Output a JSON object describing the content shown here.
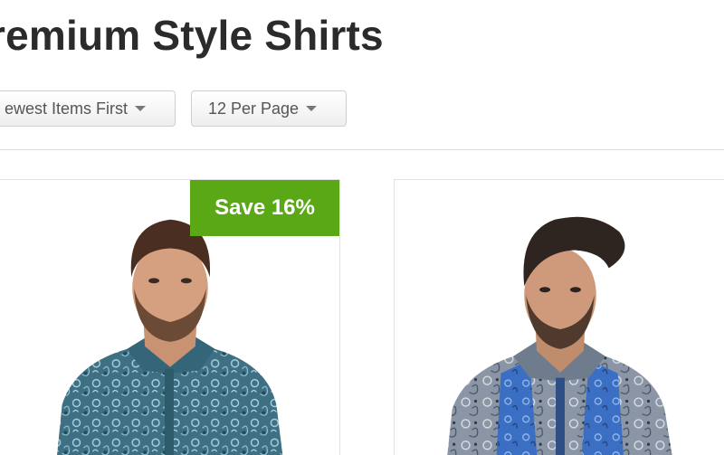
{
  "page": {
    "title": "remium Style Shirts"
  },
  "toolbar": {
    "sort_label": "ewest Items First",
    "per_page_label": "12 Per Page"
  },
  "products": [
    {
      "badge": "Save 16%",
      "icon": "paisley-teal-shirt-photo",
      "colors": {
        "shirt": "#3e6f83",
        "badge": "#5aa816"
      }
    },
    {
      "icon": "paisley-blue-shirt-photo",
      "colors": {
        "shirt": "#6d86a8"
      }
    }
  ],
  "colors": {
    "title": "#2b2b2b",
    "badge_bg": "#5aa816",
    "divider": "#dddddd",
    "card_border": "#e2e2e2"
  }
}
